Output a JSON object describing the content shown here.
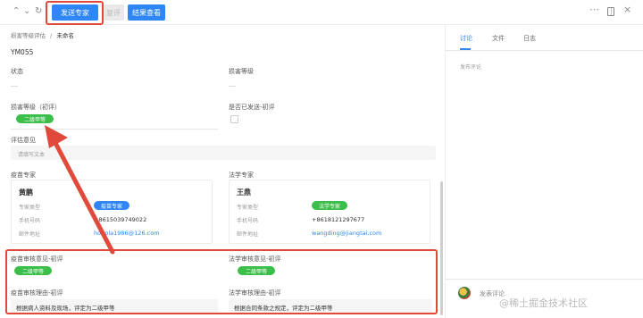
{
  "toolbar": {
    "send_expert": "发送专家",
    "reset": "复评",
    "view_results": "结果查看",
    "more_icon": "more-horizontal-icon",
    "layout_icon": "layout-icon",
    "close_icon": "close-icon"
  },
  "breadcrumb": {
    "parent": "损害等级评估",
    "sep": "/",
    "current": "未命名"
  },
  "record": {
    "id": "YM055"
  },
  "fields": {
    "status_label": "状态",
    "damage_level_label": "损害等级",
    "damage_level_initial_label": "损害等级（初评）",
    "damage_level_initial_value": "二级甲等",
    "sent_initial_label": "是否已发送-初评",
    "evaluator_label": "评估意见",
    "evaluator_placeholder": "请填写文本"
  },
  "experts": {
    "vaccine_label": "疫苗专家",
    "law_label": "法学专家",
    "vaccine_card": {
      "name": "黄鹏",
      "type_label": "专家类型",
      "type_value": "疫苗专家",
      "phone_label": "手机号码",
      "phone_value": "+8615039749022",
      "email_label": "邮件地址",
      "email_value": "honpla1986@126.com"
    },
    "law_card": {
      "name": "王鼎",
      "type_label": "专家类型",
      "type_value": "法学专家",
      "phone_label": "手机号码",
      "phone_value": "+8618121297677",
      "email_label": "邮件地址",
      "email_value": "wangding@jiangtai.com"
    }
  },
  "review": {
    "vaccine_opinion_label": "疫苗审核意见-初评",
    "vaccine_opinion_value": "二级甲等",
    "law_opinion_label": "法学审核意见-初评",
    "law_opinion_value": "二级甲等",
    "vaccine_reason_label": "疫苗审核理由-初评",
    "vaccine_reason_value": "根据病人资料及现场，评定为二级甲等",
    "law_reason_label": "法学审核理由-初评",
    "law_reason_value": "根据合同条款之规定，评定为二级甲等"
  },
  "sidebar": {
    "tabs": [
      "讨论",
      "文件",
      "日志"
    ],
    "active_tab": 0,
    "comment_placeholder": "发布评论",
    "bottom_comment": "发表评论"
  },
  "watermark": "@稀土掘金技术社区",
  "colors": {
    "primary": "#2f86f6",
    "green": "#3cbf4a",
    "annotation_red": "#e14a3b"
  }
}
